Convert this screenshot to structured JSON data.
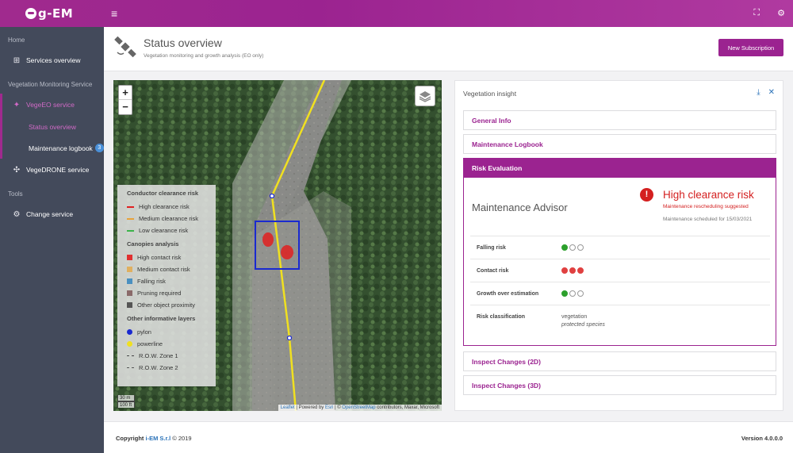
{
  "app": {
    "logo_text": "g-EM",
    "menu_icon": "hamburger-icon",
    "top_icons": [
      "fullscreen-icon",
      "settings-share-icon"
    ]
  },
  "sidebar": {
    "section_home": "Home",
    "services_overview": "Services overview",
    "section_vms": "Vegetation Monitoring Service",
    "vegeeo": "VegeEO service",
    "status_overview": "Status overview",
    "maintenance_logbook": "Maintenance logbook",
    "logbook_badge": "3",
    "vegedrone": "VegeDRONE service",
    "section_tools": "Tools",
    "change_service": "Change service"
  },
  "header": {
    "title": "Status overview",
    "subtitle": "Vegetation monitoring and growth analysis (EO only)",
    "new_subscription": "New Subscription"
  },
  "map": {
    "zoom_in": "+",
    "zoom_out": "−",
    "legend": {
      "conductor_title": "Conductor clearance risk",
      "conductor": [
        {
          "label": "High clearance risk",
          "color": "#e02020"
        },
        {
          "label": "Medium clearance risk",
          "color": "#e8a33a"
        },
        {
          "label": "Low clearance risk",
          "color": "#3cb34a"
        }
      ],
      "canopies_title": "Canopies analysis",
      "canopies": [
        {
          "label": "High contact risk",
          "color": "#e03030"
        },
        {
          "label": "Medium contact risk",
          "color": "#e0b060"
        },
        {
          "label": "Falling risk",
          "color": "#4a90c0"
        },
        {
          "label": "Pruning required",
          "color": "#8a6a6a"
        },
        {
          "label": "Other object proximity",
          "color": "#555555"
        }
      ],
      "other_title": "Other informative layers",
      "other": [
        {
          "label": "pylon",
          "color": "#1a2ad0"
        },
        {
          "label": "powerline",
          "color": "#f0e020"
        },
        {
          "label": "R.O.W. Zone 1",
          "color": "#444444"
        },
        {
          "label": "R.O.W. Zone 2",
          "color": "#555555"
        }
      ]
    },
    "scale_m": "30 m",
    "scale_ft": "100 ft",
    "attribution": {
      "leaflet": "Leaflet",
      "powered": " | Powered by ",
      "esri": "Esri",
      "sep": " | © ",
      "osm": "OpenStreetMap",
      "rest": " contributors, Maxar, Microsoft"
    }
  },
  "panel": {
    "title": "Vegetation insight",
    "download_icon": "download-icon",
    "close_icon": "close-icon",
    "sections": {
      "general": "General Info",
      "logbook": "Maintenance Logbook",
      "risk": "Risk Evaluation",
      "changes2d": "Inspect Changes (2D)",
      "changes3d": "Inspect Changes (3D)"
    },
    "risk": {
      "advisor": "Maintenance Advisor",
      "alert_title": "High clearance risk",
      "alert_sub": "Maintenance rescheduling suggested",
      "alert_sched": "Maintenance scheduled for 15/03/2021",
      "rows": [
        {
          "label": "Falling risk",
          "level": 1,
          "of": 3,
          "color": "green"
        },
        {
          "label": "Contact risk",
          "level": 3,
          "of": 3,
          "color": "red"
        },
        {
          "label": "Growth over estimation",
          "level": 1,
          "of": 3,
          "color": "green"
        }
      ],
      "classification_label": "Risk classification",
      "classification_value": "vegetation",
      "classification_note": "protected species"
    }
  },
  "footer": {
    "copyright_prefix": "Copyright ",
    "brand": "i-EM S.r.l",
    "copyright_suffix": " © 2019",
    "version": "Version 4.0.0.0"
  },
  "colors": {
    "accent": "#9b2390",
    "sidebar_bg": "#434a5b",
    "danger": "#d42020"
  }
}
